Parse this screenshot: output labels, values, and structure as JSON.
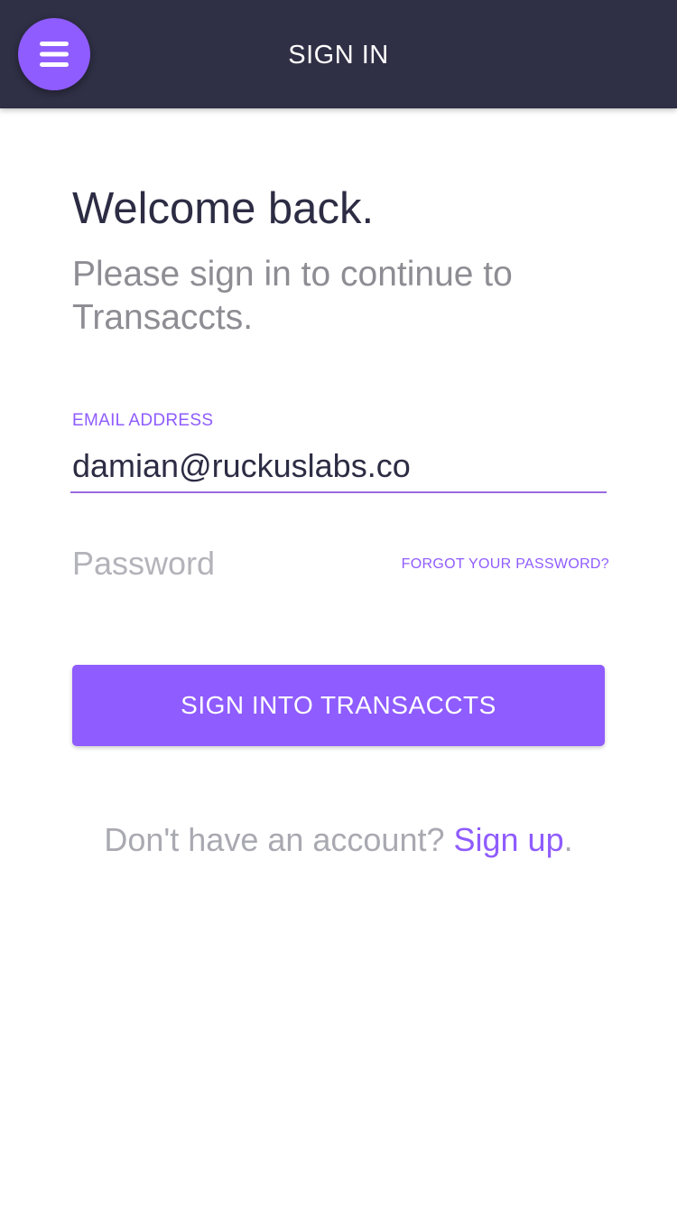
{
  "header": {
    "title": "SIGN IN",
    "menu_icon": "hamburger-menu-icon"
  },
  "intro": {
    "heading": "Welcome back.",
    "subtitle": "Please sign in to continue to Transaccts."
  },
  "form": {
    "email_label": "EMAIL ADDRESS",
    "email_value": "damian@ruckuslabs.co",
    "password_placeholder": "Password",
    "password_value": "",
    "forgot_label": "FORGOT YOUR PASSWORD?",
    "submit_label": "SIGN INTO TRANSACCTS"
  },
  "footer": {
    "prompt": "Don't have an account? ",
    "signup_label": "Sign up",
    "punctuation": "."
  },
  "colors": {
    "header_bg": "#2f2f45",
    "accent": "#8f5cff",
    "heading_text": "#2c2c44",
    "muted_text": "#8d8d93"
  }
}
